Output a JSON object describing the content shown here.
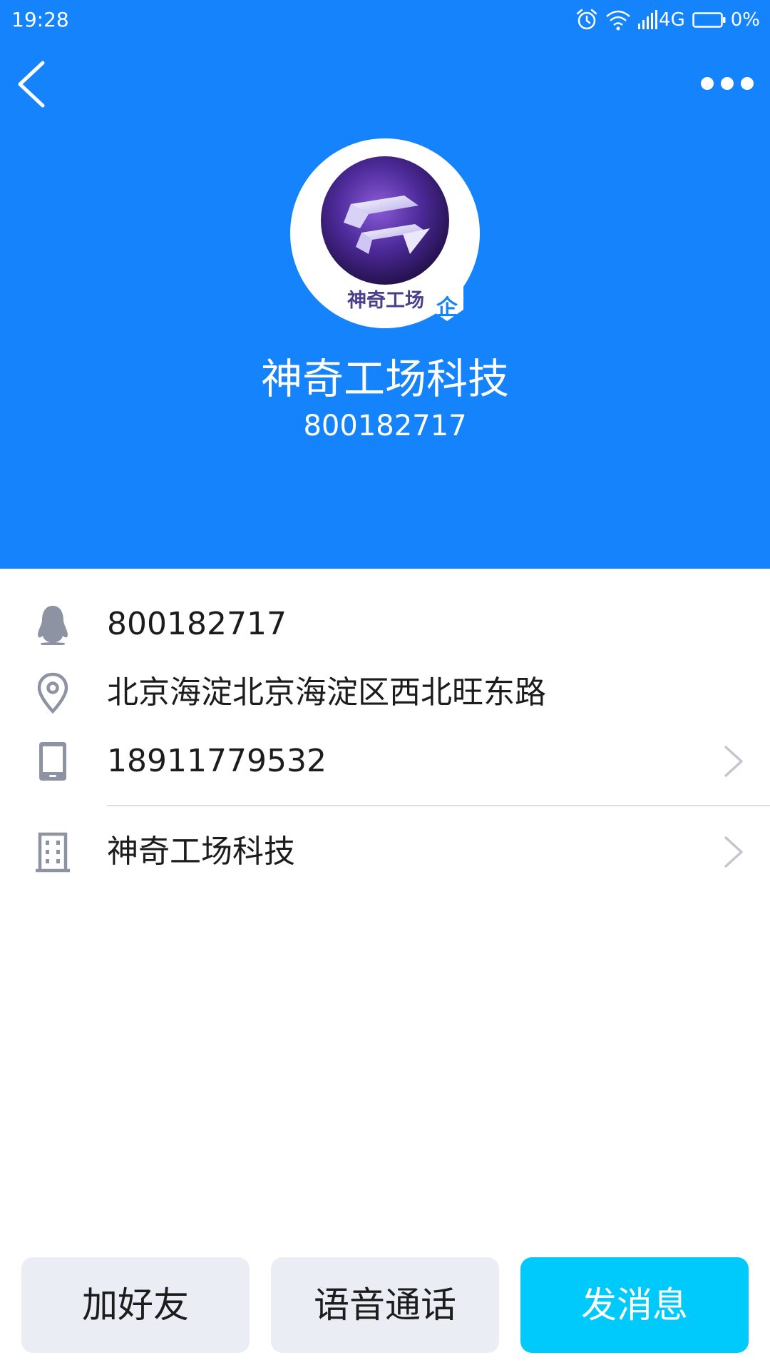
{
  "status_bar": {
    "time": "19:28",
    "network": "4G",
    "battery": "0%"
  },
  "header": {
    "background_color": "#1583fb",
    "back_icon": "chevron-left-icon",
    "more_icon": "more-dots-icon"
  },
  "profile": {
    "avatar_brand_text": "神奇工场",
    "enterprise_badge": "企",
    "name": "神奇工场科技",
    "id": "800182717"
  },
  "info": {
    "qq": {
      "icon": "penguin-icon",
      "value": "800182717"
    },
    "location": {
      "icon": "location-pin-icon",
      "value": "北京海淀北京海淀区西北旺东路"
    },
    "phone": {
      "icon": "phone-icon",
      "value": "18911779532"
    },
    "company": {
      "icon": "building-icon",
      "value": "神奇工场科技"
    }
  },
  "actions": {
    "add_friend": "加好友",
    "voice_call": "语音通话",
    "send_message": "发消息"
  },
  "colors": {
    "primary_button": "#00cafc",
    "secondary_button": "#ebedf5",
    "icon": "#8e93a3"
  }
}
